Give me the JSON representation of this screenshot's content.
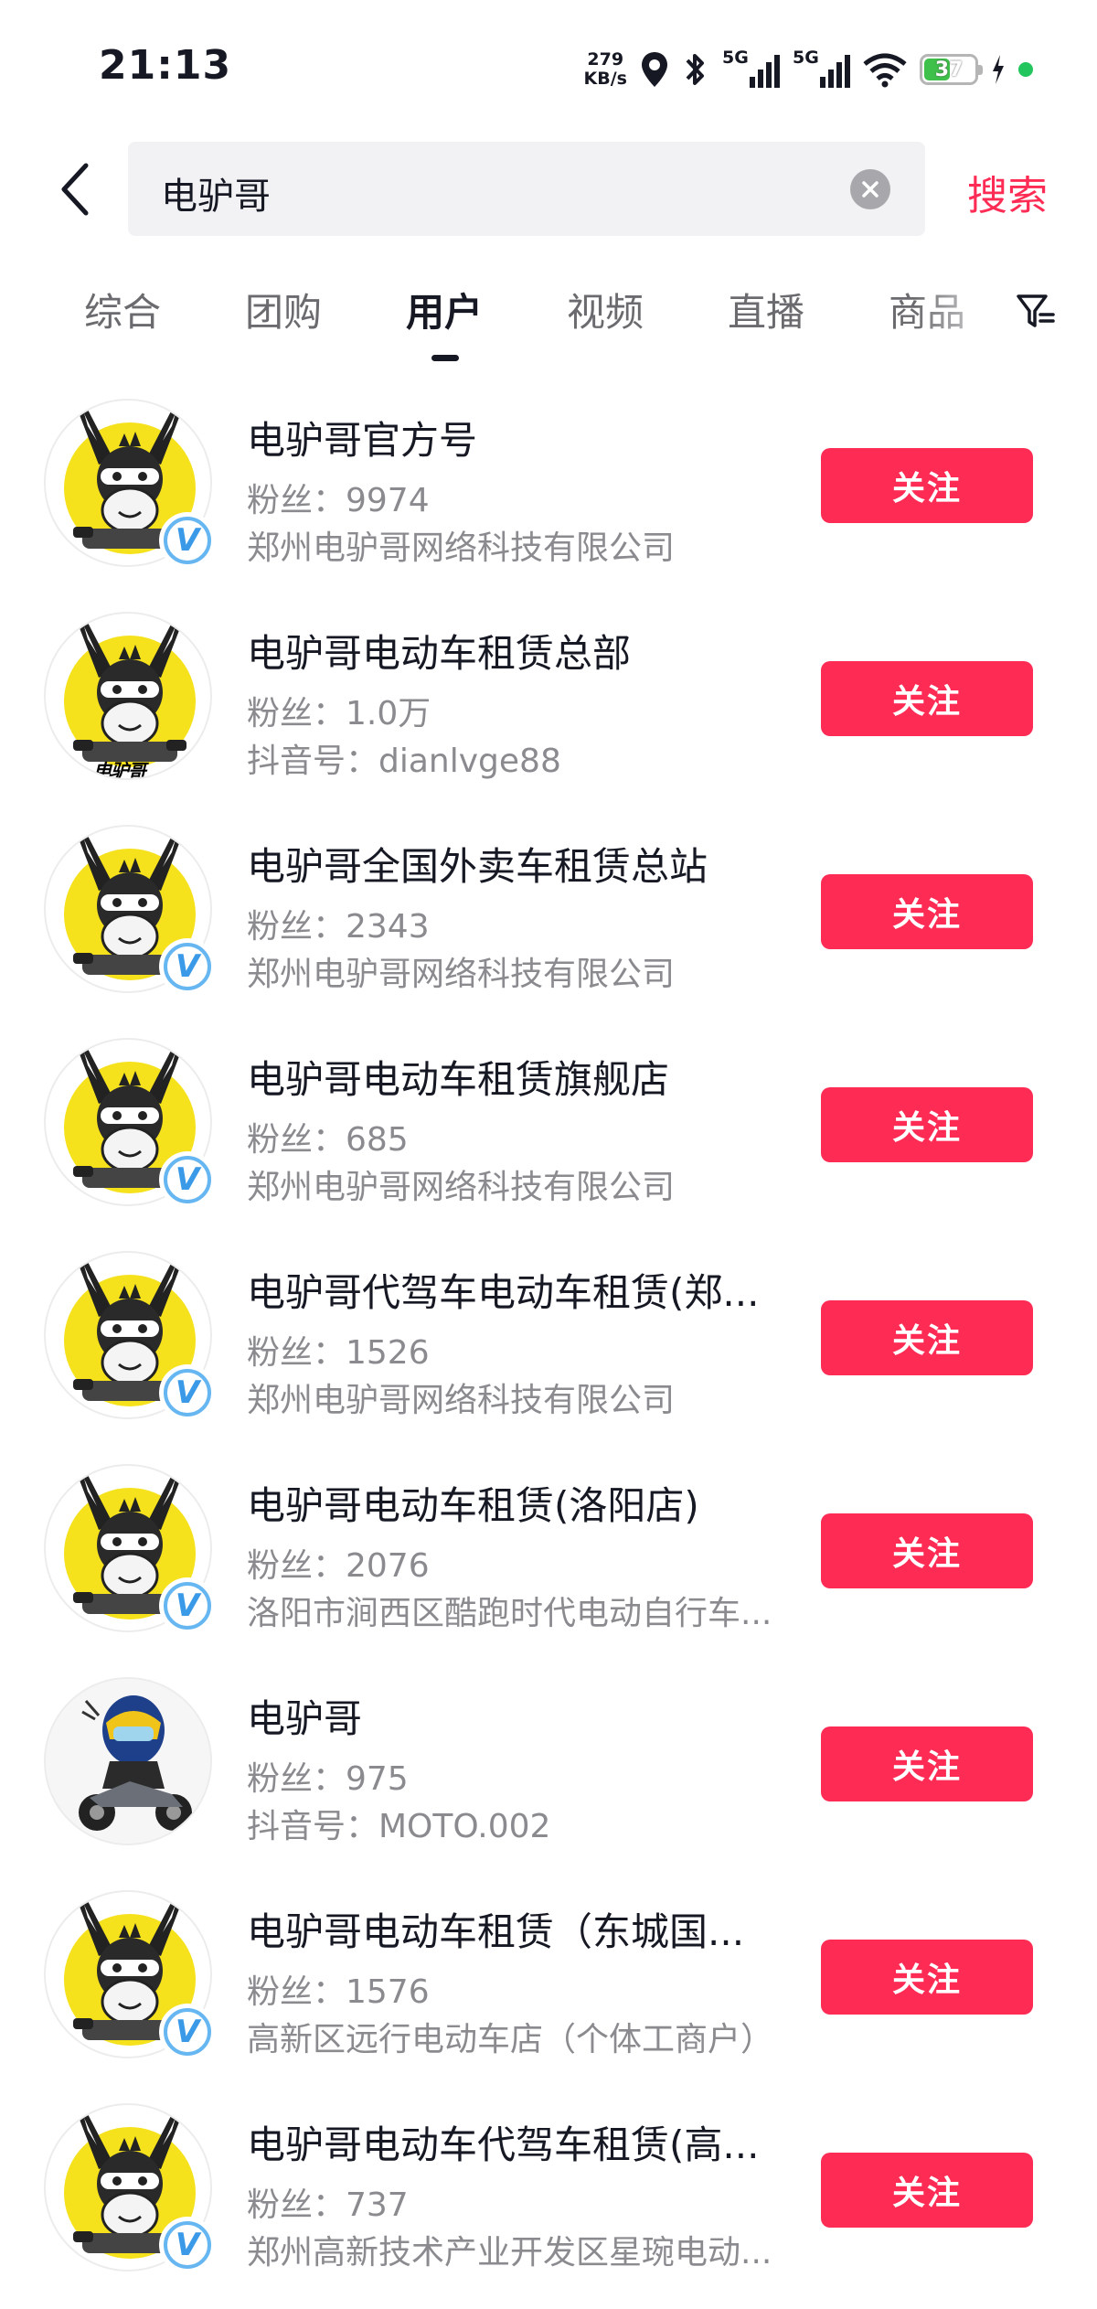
{
  "status_bar": {
    "time": "21:13",
    "net_speed_value": "279",
    "net_speed_unit": "KB/s",
    "signal1_label": "5G",
    "signal2_label": "5G",
    "battery_level": "37",
    "icons": [
      "location-icon",
      "bluetooth-icon",
      "signal-icon",
      "signal-icon",
      "wifi-icon",
      "battery-icon",
      "charging-icon",
      "dot-icon"
    ]
  },
  "header": {
    "search_value": "电驴哥",
    "search_button": "搜索"
  },
  "tabs": {
    "items": [
      "综合",
      "团购",
      "用户",
      "视频",
      "直播",
      "商品"
    ],
    "active": "用户"
  },
  "follow_label": "关注",
  "results": [
    {
      "name": "电驴哥官方号",
      "fans": "粉丝：9974",
      "sub": "郑州电驴哥网络科技有限公司",
      "verified": true,
      "avatar": "donkey-logo"
    },
    {
      "name": "电驴哥电动车租赁总部",
      "fans": "粉丝：1.0万",
      "sub": "抖音号：dianlvge88",
      "verified": false,
      "avatar": "donkey-logo-with-caption",
      "avatar_caption": "电驴哥"
    },
    {
      "name": "电驴哥全国外卖车租赁总站",
      "fans": "粉丝：2343",
      "sub": "郑州电驴哥网络科技有限公司",
      "verified": true,
      "avatar": "donkey-logo"
    },
    {
      "name": "电驴哥电动车租赁旗舰店",
      "fans": "粉丝：685",
      "sub": "郑州电驴哥网络科技有限公司",
      "verified": true,
      "avatar": "donkey-logo"
    },
    {
      "name": "电驴哥代驾车电动车租赁(郑...",
      "fans": "粉丝：1526",
      "sub": "郑州电驴哥网络科技有限公司",
      "verified": true,
      "avatar": "donkey-logo"
    },
    {
      "name": "电驴哥电动车租赁(洛阳店)",
      "fans": "粉丝：2076",
      "sub": "洛阳市涧西区酷跑时代电动自行车...",
      "verified": true,
      "avatar": "donkey-logo"
    },
    {
      "name": "电驴哥",
      "fans": "粉丝：975",
      "sub": "抖音号：MOTO.002",
      "verified": false,
      "avatar": "motorcycle-rider"
    },
    {
      "name": "电驴哥电动车租赁（东城国...",
      "fans": "粉丝：1576",
      "sub": "高新区远行电动车店（个体工商户）",
      "verified": true,
      "avatar": "donkey-logo"
    },
    {
      "name": "电驴哥电动车代驾车租赁(高...",
      "fans": "粉丝：737",
      "sub": "郑州高新技术产业开发区星琬电动...",
      "verified": true,
      "avatar": "donkey-logo"
    }
  ],
  "colors": {
    "accent": "#fe2c55",
    "verified_blue": "#65b6f1",
    "donkey_yellow": "#f5e21c"
  }
}
